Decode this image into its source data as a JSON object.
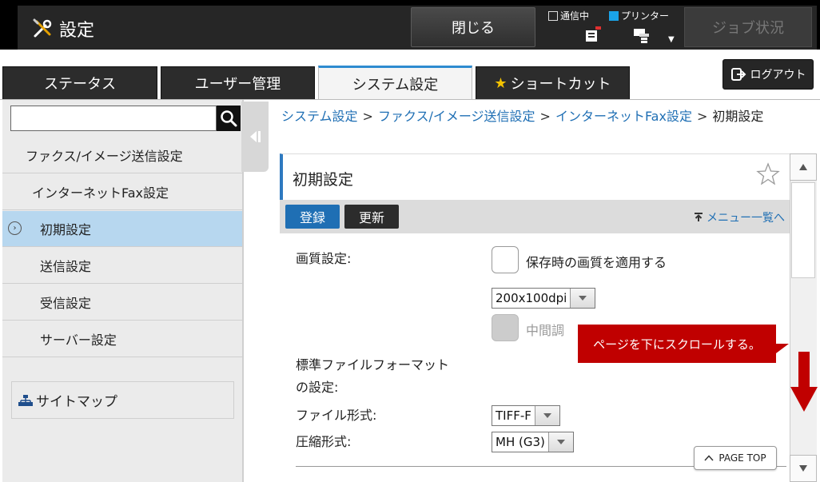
{
  "header": {
    "title": "設定",
    "close_label": "閉じる",
    "status_comm": "通信中",
    "status_printer": "プリンター",
    "job_status_label": "ジョブ状況"
  },
  "tabs": [
    {
      "label": "ステータス",
      "active": false
    },
    {
      "label": "ユーザー管理",
      "active": false
    },
    {
      "label": "システム設定",
      "active": true
    },
    {
      "label": "ショートカット",
      "active": false
    }
  ],
  "logout_label": "ログアウト",
  "sidebar": {
    "search_value": "",
    "items": [
      {
        "label": "ファクス/イメージ送信設定",
        "level": 1
      },
      {
        "label": "インターネットFax設定",
        "level": 2
      },
      {
        "label": "初期設定",
        "level": 3,
        "selected": true
      },
      {
        "label": "送信設定",
        "level": 3
      },
      {
        "label": "受信設定",
        "level": 3
      },
      {
        "label": "サーバー設定",
        "level": 3
      }
    ],
    "sitemap_label": "サイトマップ"
  },
  "breadcrumb": {
    "items": [
      "システム設定",
      "ファクス/イメージ送信設定",
      "インターネットFax設定"
    ],
    "current": "初期設定",
    "separator": ">"
  },
  "panel": {
    "title": "初期設定",
    "register_label": "登録",
    "update_label": "更新",
    "menu_list_label": "メニュー一覧へ"
  },
  "form": {
    "quality_label": "画質設定:",
    "apply_quality_label": "保存時の画質を適用する",
    "resolution_value": "200x100dpi",
    "halftone_label": "中間調",
    "std_format_label_1": "標準ファイルフォーマット",
    "std_format_label_2": "の設定:",
    "file_type_label": "ファイル形式:",
    "file_type_value": "TIFF-F",
    "compression_label": "圧縮形式:",
    "compression_value": "MH (G3)"
  },
  "page_top_label": "PAGE TOP",
  "annotation": {
    "text": "ページを下にスクロールする。"
  },
  "colors": {
    "accent_blue": "#1f6fb4",
    "tab_active_border": "#2e8bd0",
    "annotation_red": "#c00000",
    "selected_item_bg": "#b7d7ef"
  }
}
